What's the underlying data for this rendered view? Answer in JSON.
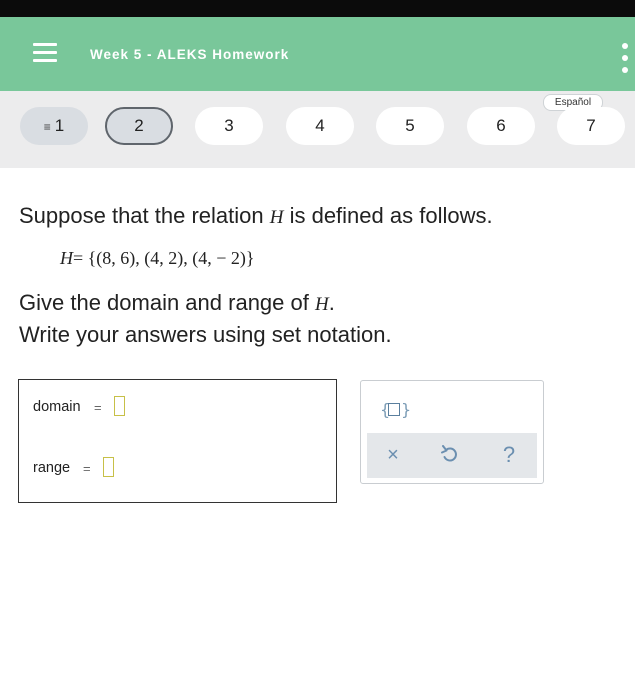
{
  "header": {
    "title": "Week 5 - ALEKS Homework"
  },
  "question_nav": {
    "language_label": "Español",
    "items": [
      {
        "label": "1"
      },
      {
        "label": "2"
      },
      {
        "label": "3"
      },
      {
        "label": "4"
      },
      {
        "label": "5"
      },
      {
        "label": "6"
      },
      {
        "label": "7"
      }
    ]
  },
  "problem": {
    "line1_prefix": "Suppose that the relation ",
    "relation_var": "H",
    "line1_suffix": " is defined as follows.",
    "set_lhs": "H",
    "set_rhs": "= {(8, 6), (4, 2), (4, − 2)}",
    "line2_prefix": "Give the domain and range of ",
    "line2_var": "H",
    "line2_suffix": ".",
    "line3": "Write your answers using set notation."
  },
  "answers": {
    "domain_label": "domain",
    "domain_eq": "=",
    "domain_value": "",
    "range_label": "range",
    "range_eq": "=",
    "range_value": ""
  },
  "tools": {
    "set_brace_left": "{",
    "set_brace_right": "}",
    "clear_symbol": "×",
    "help_symbol": "?"
  },
  "colors": {
    "header_bg": "#79c79a",
    "nav_bg": "#ececed",
    "input_border": "#c7c047",
    "tool_icon": "#6b8fb0"
  }
}
